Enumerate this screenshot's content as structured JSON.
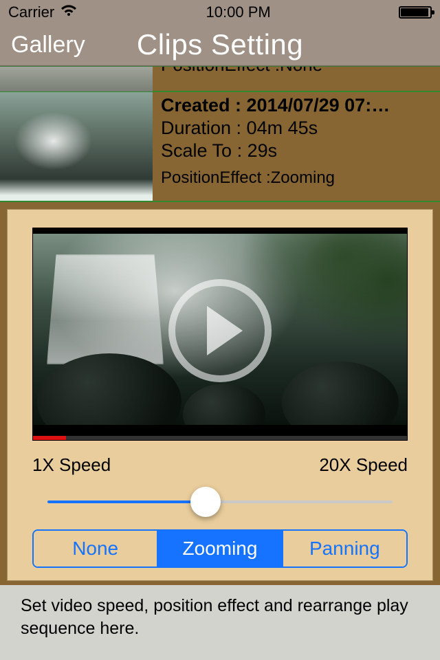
{
  "status": {
    "carrier": "Carrier",
    "time": "10:00 PM"
  },
  "nav": {
    "back": "Gallery",
    "title": "Clips Setting"
  },
  "list": {
    "peek_effect": "PositionEffect :None",
    "selected": {
      "created": "Created : 2014/07/29 07:…",
      "duration": "Duration : 04m 45s",
      "scale": "Scale To : 29s",
      "effect": "PositionEffect :Zooming"
    }
  },
  "editor": {
    "speed_min": "1X Speed",
    "speed_max": "20X Speed",
    "segments": {
      "none": "None",
      "zooming": "Zooming",
      "panning": "Panning",
      "selected": "zooming"
    }
  },
  "help": "Set video speed, position effect and rearrange play sequence here."
}
